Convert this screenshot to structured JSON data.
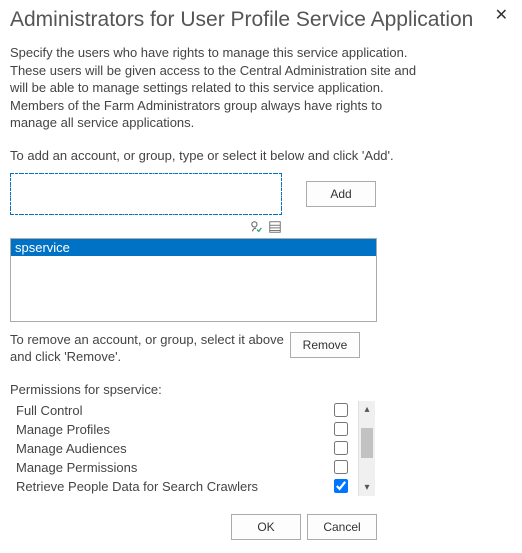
{
  "dialog": {
    "title": "Administrators for User Profile Service Application",
    "close_glyph": "✕",
    "description": "Specify the users who have rights to manage this service application. These users will be given access to the Central Administration site and will be able to manage settings related to this service application. Members of the Farm Administrators group always have rights to manage all service applications.",
    "add_instruction": "To add an account, or group, type or select it below and click 'Add'.",
    "add_button": "Add",
    "remove_instruction": "To remove an account, or group, select it above and click 'Remove'.",
    "remove_button": "Remove",
    "ok_button": "OK",
    "cancel_button": "Cancel"
  },
  "account_input": {
    "value": ""
  },
  "accounts": [
    {
      "name": "spservice",
      "selected": true
    }
  ],
  "permissions": {
    "header": "Permissions for spservice:",
    "items": [
      {
        "label": "Full Control",
        "checked": false
      },
      {
        "label": "Manage Profiles",
        "checked": false
      },
      {
        "label": "Manage Audiences",
        "checked": false
      },
      {
        "label": "Manage Permissions",
        "checked": false
      },
      {
        "label": "Retrieve People Data for Search Crawlers",
        "checked": true
      }
    ]
  }
}
